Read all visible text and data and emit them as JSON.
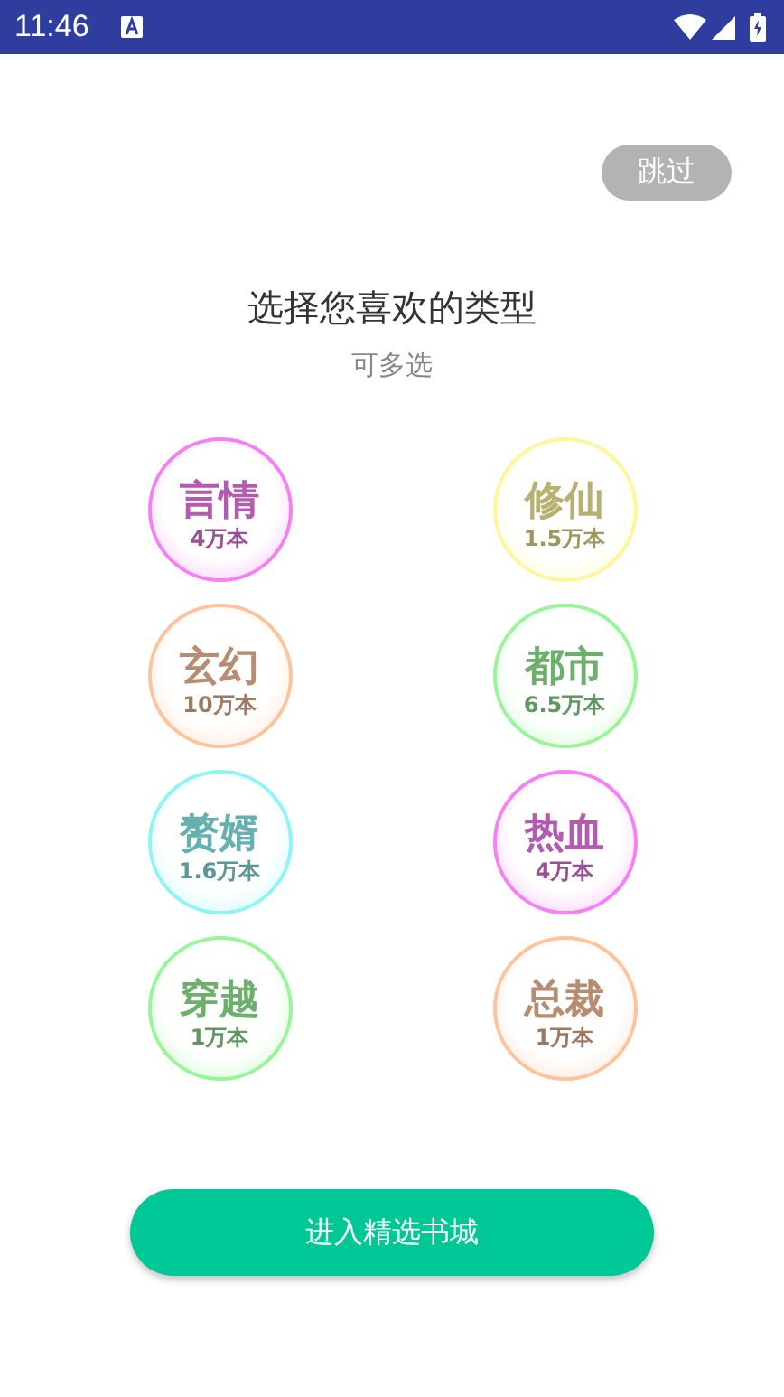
{
  "status_bar": {
    "time": "11:46"
  },
  "skip_button": "跳过",
  "title": "选择您喜欢的类型",
  "subtitle": "可多选",
  "genres": [
    {
      "name": "言情",
      "count": "4万本",
      "color": "#f77ff5"
    },
    {
      "name": "修仙",
      "count": "1.5万本",
      "color": "#fff59a"
    },
    {
      "name": "玄幻",
      "count": "10万本",
      "color": "#ffc39c"
    },
    {
      "name": "都市",
      "count": "6.5万本",
      "color": "#98f598"
    },
    {
      "name": "赘婿",
      "count": "1.6万本",
      "color": "#8ef5f7"
    },
    {
      "name": "热血",
      "count": "4万本",
      "color": "#f77ff5"
    },
    {
      "name": "穿越",
      "count": "1万本",
      "color": "#98f598"
    },
    {
      "name": "总裁",
      "count": "1万本",
      "color": "#ffc39c"
    }
  ],
  "enter_button": "进入精选书城"
}
